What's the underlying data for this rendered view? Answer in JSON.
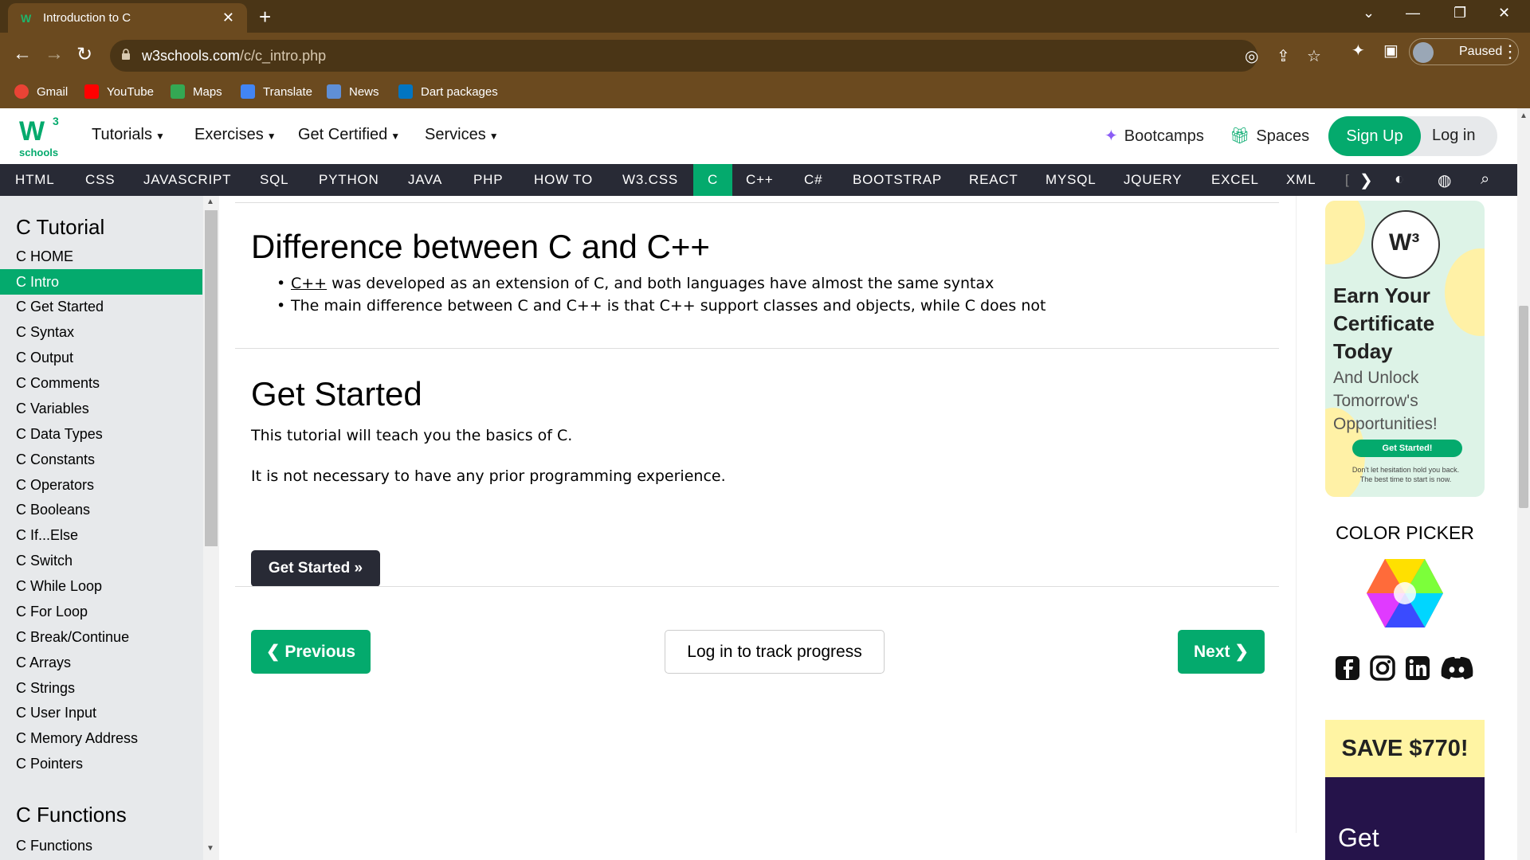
{
  "browser": {
    "tab_title": "Introduction to C",
    "url_domain": "w3schools.com",
    "url_path": "/c/c_intro.php",
    "profile_status": "Paused",
    "bookmarks": [
      "Gmail",
      "YouTube",
      "Maps",
      "Translate",
      "News",
      "Dart packages"
    ]
  },
  "site": {
    "logo_sup": "3",
    "logo_text": "schools",
    "menus": [
      "Tutorials",
      "Exercises",
      "Get Certified",
      "Services"
    ],
    "bootcamps": "Bootcamps",
    "spaces": "Spaces",
    "signup": "Sign Up",
    "login": "Log in",
    "langs": [
      "HTML",
      "CSS",
      "JAVASCRIPT",
      "SQL",
      "PYTHON",
      "JAVA",
      "PHP",
      "HOW TO",
      "W3.CSS",
      "C",
      "C++",
      "C#",
      "BOOTSTRAP",
      "REACT",
      "MYSQL",
      "JQUERY",
      "EXCEL",
      "XML",
      "["
    ],
    "active_lang": "C",
    "accent": "#04aa6d"
  },
  "sidebar": {
    "heading1": "C Tutorial",
    "items": [
      "C HOME",
      "C Intro",
      "C Get Started",
      "C Syntax",
      "C Output",
      "C Comments",
      "C Variables",
      "C Data Types",
      "C Constants",
      "C Operators",
      "C Booleans",
      "C If...Else",
      "C Switch",
      "C While Loop",
      "C For Loop",
      "C Break/Continue",
      "C Arrays",
      "C Strings",
      "C User Input",
      "C Memory Address",
      "C Pointers"
    ],
    "active_item": "C Intro",
    "heading2": "C Functions",
    "item_after": "C Functions"
  },
  "main": {
    "section1_title": "Difference between C and C++",
    "bullet1_link": "C++",
    "bullet1_rest": " was developed as an extension of C, and both languages have almost the same syntax",
    "bullet2": "The main difference between C and C++ is that C++ support classes and objects, while C does not",
    "section2_title": "Get Started",
    "para1": "This tutorial will teach you the basics of C.",
    "para2": "It is not necessary to have any prior programming experience.",
    "get_started_btn": "Get Started »",
    "prev_btn": "❮ Previous",
    "track_btn": "Log in to track progress",
    "next_btn": "Next ❯"
  },
  "right": {
    "ad1_title": [
      "Earn Your",
      "Certificate",
      "Today"
    ],
    "ad1_sub": [
      "And Unlock",
      "Tomorrow's",
      "Opportunities!"
    ],
    "ad1_cta": "Get Started!",
    "ad1_fine": [
      "Don't let hesitation hold you back.",
      "The best time to start is now."
    ],
    "color_picker": "COLOR PICKER",
    "ad2_headline": "SAVE $770!",
    "ad2_sub": "Get"
  }
}
